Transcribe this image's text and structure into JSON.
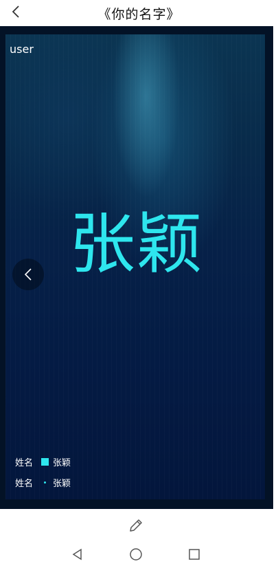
{
  "header": {
    "title": "《你的名字》"
  },
  "card": {
    "user_label": "user",
    "name": "张颖"
  },
  "legend": [
    {
      "key": "姓名",
      "value": "张颖",
      "swatch": "square"
    },
    {
      "key": "姓名",
      "value": "张颖",
      "swatch": "dot"
    }
  ],
  "colors": {
    "accent": "#2ee6ee",
    "background": "#031226"
  },
  "icons": {
    "back": "chevron-left-icon",
    "prev": "chevron-left-icon",
    "edit": "pencil-icon",
    "nav_back": "triangle-back-icon",
    "nav_home": "circle-home-icon",
    "nav_recent": "square-recent-icon"
  }
}
